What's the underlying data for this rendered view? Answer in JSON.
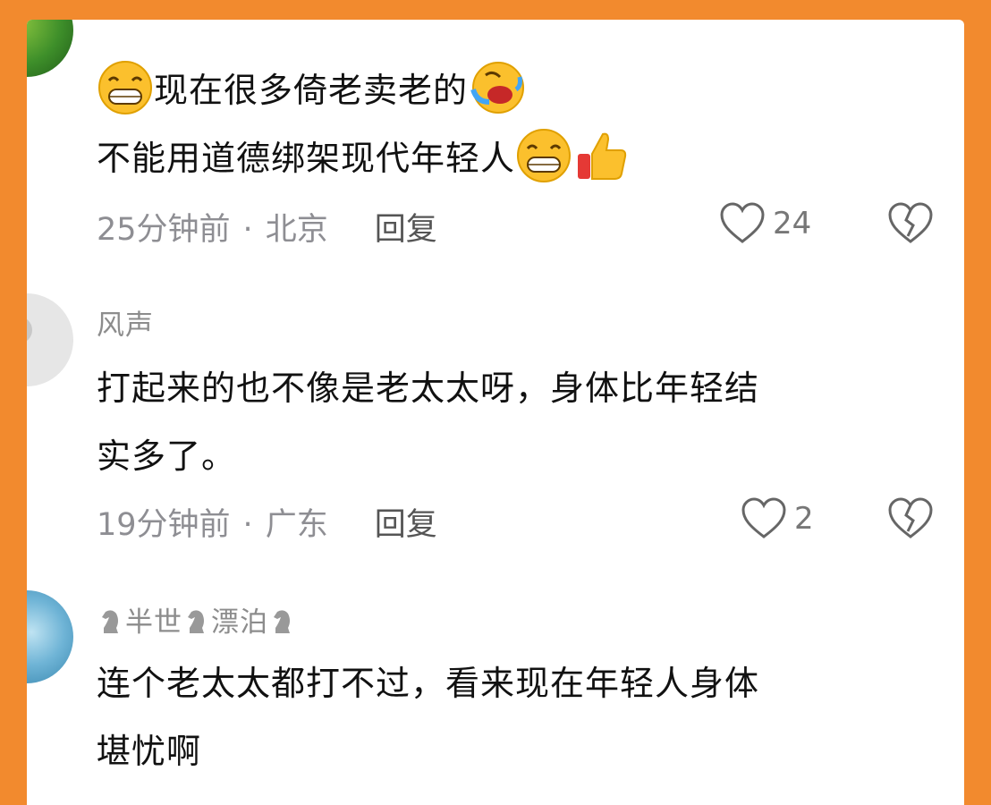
{
  "comments": [
    {
      "lines": [
        "现在很多倚老卖老的",
        "不能用道德绑架现代年轻人"
      ],
      "time": "25分钟前",
      "location": "北京",
      "reply_label": "回复",
      "likes": "24"
    },
    {
      "username": "风声",
      "lines": [
        "打起来的也不像是老太太呀，身体比年轻结",
        "实多了。"
      ],
      "time": "19分钟前",
      "location": "广东",
      "reply_label": "回复",
      "likes": "2"
    },
    {
      "username_parts": [
        "半世",
        "漂泊"
      ],
      "lines": [
        "连个老太太都打不过，看来现在年轻人身体",
        "堪忧啊"
      ]
    }
  ],
  "icons": {
    "grin": "grinning-face-emoji",
    "laugh_cry": "laughing-crying-emoji",
    "thumb": "thumbs-up-emoji",
    "horse": "chess-knight-icon",
    "like": "heart-outline-icon",
    "dislike": "broken-heart-icon"
  },
  "colors": {
    "frame": "#f28a2e",
    "meta_text": "#8e8e93",
    "body_text": "#111111"
  }
}
